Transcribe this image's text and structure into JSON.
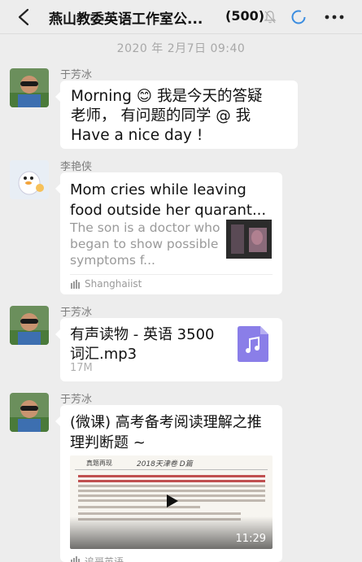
{
  "header": {
    "title": "燕山教委英语工作室公...",
    "member_count": "(500)"
  },
  "timestamp": "2020 年 2月7日 09:40",
  "messages": [
    {
      "sender": "于芳冰",
      "text_line1": "Morning 😊 我是今天的答疑",
      "text_line2": "老师， 有问题的同学 @ 我",
      "text_line3": "Have a nice day !"
    },
    {
      "sender": "李艳侠",
      "card_title": "Mom cries while leaving food outside her quarant...",
      "card_desc": "The son is a doctor who began to show possible symptoms f...",
      "card_source": "Shanghaiist"
    },
    {
      "sender": "于芳冰",
      "file_name": "有声读物 - 英语 3500 词汇.mp3",
      "file_size": "17M"
    },
    {
      "sender": "于芳冰",
      "video_title": "(微课) 高考备考阅读理解之推理判断题 ~",
      "video_head": "真题再现",
      "video_head2": "2018天津卷 D篇",
      "video_duration": "11:29",
      "video_source": "追哥英语"
    }
  ],
  "icons": {
    "back": "chevron-left-icon",
    "mute": "bell-mute-icon",
    "status": "loading-ring-icon",
    "more": "ellipsis-icon",
    "audio_file": "music-note-icon",
    "play": "play-icon"
  },
  "colors": {
    "background": "#ededed",
    "bubble": "#ffffff",
    "audio_icon": "#8a7ee8",
    "loading_ring": "#3b8de0"
  }
}
